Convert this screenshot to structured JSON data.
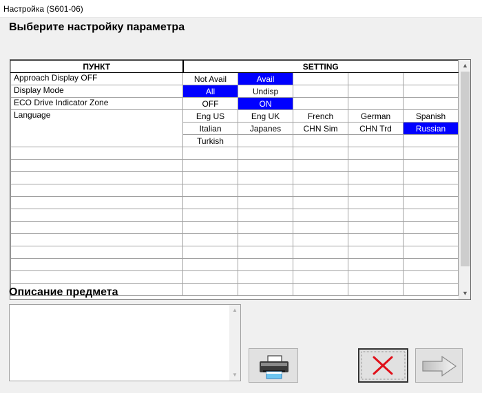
{
  "window": {
    "title": "Настройка (S601-06)"
  },
  "header": {
    "title": "Выберите настройку параметра"
  },
  "table": {
    "columns": [
      "ПУНКТ",
      "SETTING"
    ],
    "rows": [
      {
        "item": "Approach Display OFF",
        "values": [
          "Not Avail",
          "Avail",
          "",
          "",
          ""
        ],
        "selected": [
          false,
          true,
          false,
          false,
          false
        ]
      },
      {
        "item": "Display Mode",
        "values": [
          "All",
          "Undisp",
          "",
          "",
          ""
        ],
        "selected": [
          true,
          false,
          false,
          false,
          false
        ]
      },
      {
        "item": "ECO Drive Indicator Zone",
        "values": [
          "OFF",
          "ON",
          "",
          "",
          ""
        ],
        "selected": [
          false,
          true,
          false,
          false,
          false
        ]
      },
      {
        "item": "Language",
        "values": [
          "Eng US",
          "Eng UK",
          "French",
          "German",
          "Spanish"
        ],
        "selected": [
          false,
          false,
          false,
          false,
          false
        ]
      },
      {
        "item": "",
        "values": [
          "Italian",
          "Japanes",
          "CHN Sim",
          "CHN Trd",
          "Russian"
        ],
        "selected": [
          false,
          false,
          false,
          false,
          true
        ]
      },
      {
        "item": "",
        "values": [
          "Turkish",
          "",
          "",
          "",
          ""
        ],
        "selected": [
          false,
          false,
          false,
          false,
          false
        ]
      }
    ],
    "empty_rows": 12
  },
  "description": {
    "title": "Описание предмета",
    "text": ""
  },
  "buttons": {
    "print_icon": "printer-icon",
    "cancel_icon": "red-x-icon",
    "next_icon": "arrow-right-icon"
  },
  "colors": {
    "selection": "#0000ff",
    "cancel": "#e0101a"
  }
}
